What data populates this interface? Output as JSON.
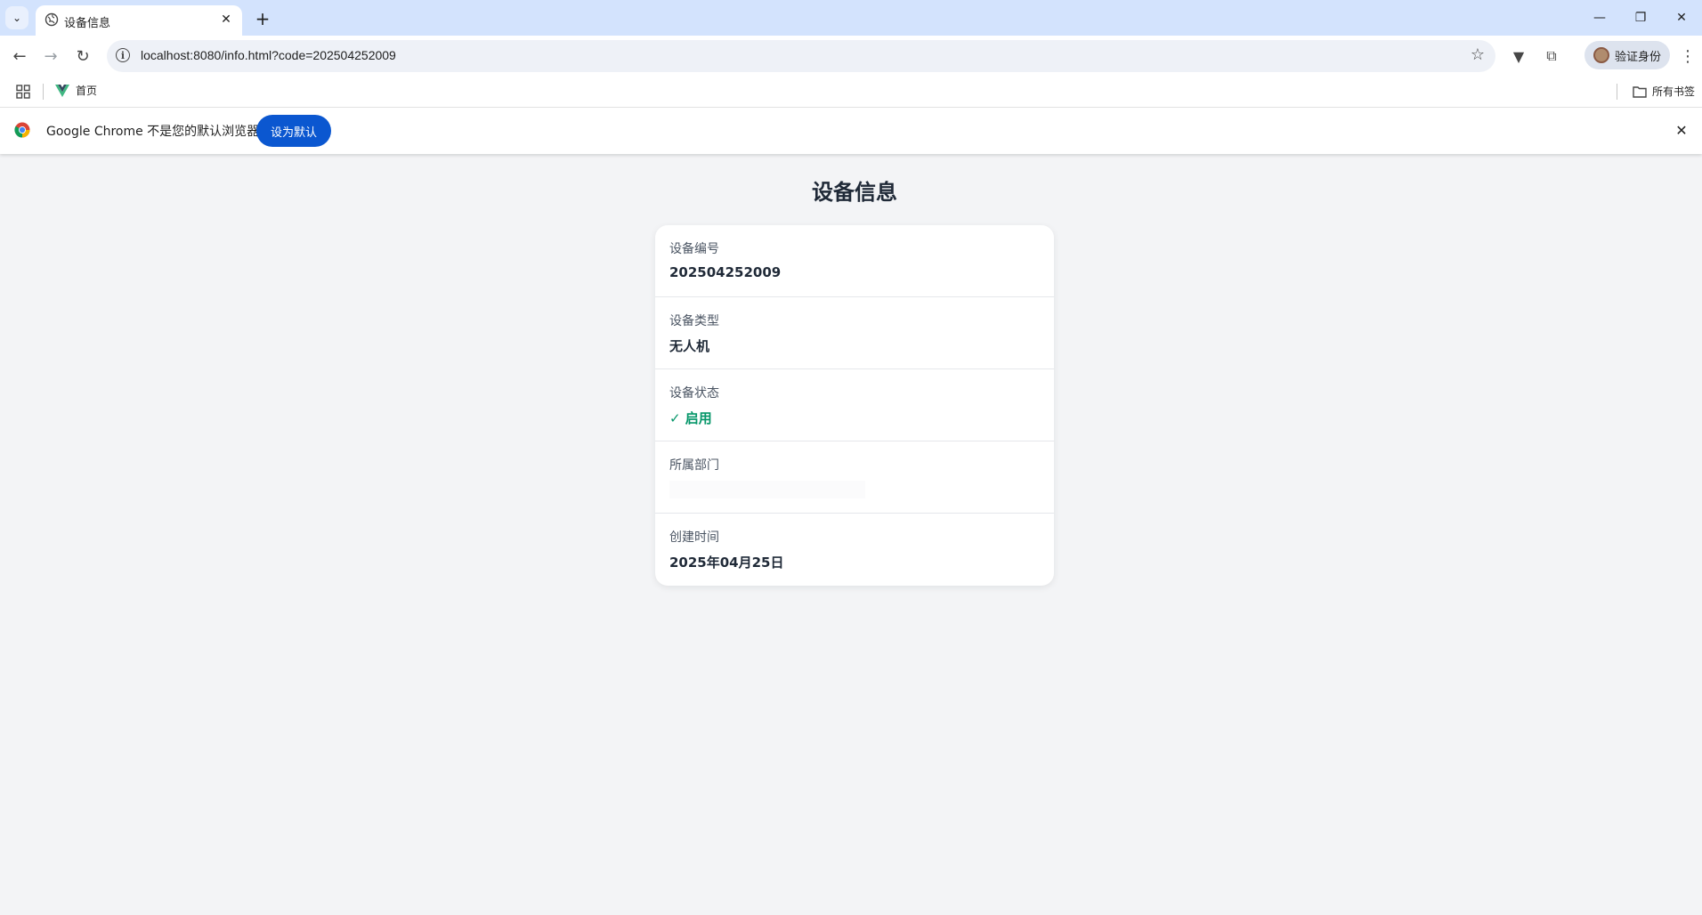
{
  "browser": {
    "tab_title": "设备信息",
    "url": "localhost:8080/info.html?code=202504252009",
    "profile_label": "验证身份",
    "bookmarks": [
      {
        "label": "首页",
        "icon": "vue-icon"
      }
    ],
    "all_bookmarks_label": "所有书签",
    "infobar_text": "Google Chrome 不是您的默认浏览器",
    "infobar_button": "设为默认"
  },
  "page": {
    "title": "设备信息",
    "fields": [
      {
        "label": "设备编号",
        "value": "202504252009"
      },
      {
        "label": "设备类型",
        "value": "无人机"
      },
      {
        "label": "设备状态",
        "value": "✓ 启用",
        "status_color": "#059669"
      },
      {
        "label": "所属部门",
        "value": ""
      },
      {
        "label": "创建时间",
        "value": "2025年04月25日"
      }
    ]
  },
  "colors": {
    "tabstrip": "#d3e3fd",
    "accent_button": "#0b57d0",
    "page_bg": "#f3f4f6",
    "status_active": "#059669"
  }
}
